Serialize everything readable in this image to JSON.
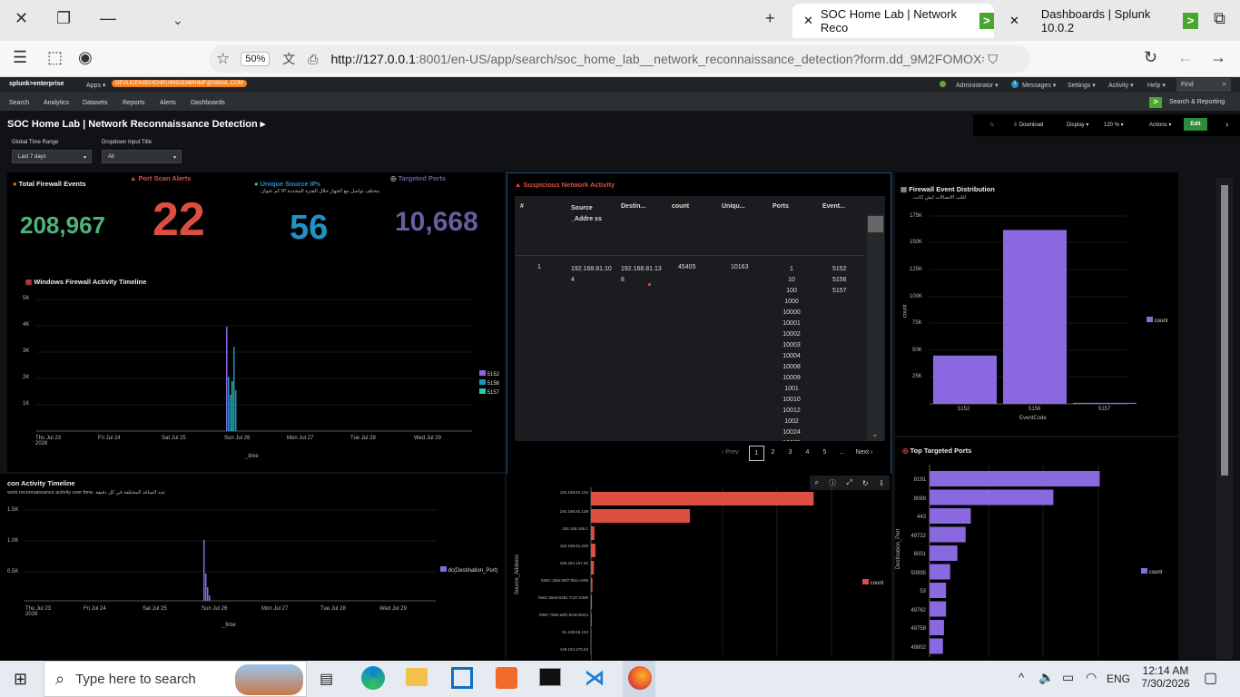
{
  "browser": {
    "tabs": [
      {
        "label": "SOC Home Lab | Network Reco"
      },
      {
        "label": "Dashboards | Splunk 10.0.2"
      }
    ],
    "zoom": "50%",
    "url_host": "http://127.0.0.1",
    "url_rest": ":8001/en-US/app/search/soc_home_lab__network_reconnaissance_detection?form.dd_9M2FOMOX=*&for"
  },
  "splunk": {
    "logo": "splunk>enterprise",
    "apps": "Apps ▾",
    "license_badge": "DEVLICENSEHDHRU4992636RHMF@GMAIL.COM",
    "admin": "Administrator ▾",
    "messages_count": "1",
    "messages": "Messages ▾",
    "settings": "Settings ▾",
    "activity": "Activity ▾",
    "help": "Help ▾",
    "find": "Find",
    "nav": [
      "Search",
      "Analytics",
      "Datasets",
      "Reports",
      "Alerts",
      "Dashboards"
    ],
    "app_name": "Search & Reporting"
  },
  "dashboard": {
    "title": "SOC Home Lab | Network Reconnaissance Detection ▸",
    "download": "Download",
    "display": "Display ▾",
    "zoom": "120 %",
    "actions": "Actions ▾",
    "edit": "Edit",
    "inputs": [
      {
        "label": "Global Time Range",
        "value": "Last 7 days"
      },
      {
        "label": "Dropdown Input Title",
        "value": "All"
      }
    ]
  },
  "kpis": [
    {
      "title": "Total Firewall Events",
      "value": "208,967",
      "color": "#4db37a"
    },
    {
      "title": "Port Scan Alerts",
      "value": "22",
      "color": "#dc4e41"
    },
    {
      "title": "Unique Source IPs",
      "subtitle": "مختلف تواصل مع الجهاز خلال الفترة المحددة IP كم عنوان",
      "value": "56",
      "color": "#1e93c6"
    },
    {
      "title": "Targeted Ports",
      "value": "10,668",
      "color": "#6a5c9e"
    }
  ],
  "timeline1": {
    "title": "Windows Firewall Activity Timeline",
    "xlabel": "_time",
    "yticks": [
      "5K",
      "4K",
      "3K",
      "2K",
      "1K"
    ],
    "xticks": [
      "Thu Jul 23\n2026",
      "Fri Jul 24",
      "Sat Jul 25",
      "Sun Jul 26",
      "Mon Jul 27",
      "Tue Jul 28",
      "Wed Jul 29"
    ],
    "legend": [
      {
        "name": "5152",
        "color": "#8a68e0"
      },
      {
        "name": "5156",
        "color": "#1e93c6"
      },
      {
        "name": "5157",
        "color": "#2ec6a4"
      }
    ]
  },
  "table": {
    "title": "Suspicious Network Activity",
    "headers": [
      "#",
      "Source _Addre ss",
      "Destin...",
      "count",
      "Uniqu...",
      "Ports",
      "Event..."
    ],
    "row": {
      "n": "1",
      "src": "192.168.81.104",
      "dst": "192.168.81.138",
      "count": "45405",
      "unique": "10163",
      "ports": [
        "1",
        "10",
        "100",
        "1000",
        "10000",
        "10001",
        "10002",
        "10003",
        "10004",
        "10008",
        "10009",
        "1001",
        "10010",
        "10012",
        "1002",
        "10024",
        "10025",
        "10030",
        "10053"
      ],
      "events": [
        "5152",
        "5156",
        "5157"
      ]
    },
    "pager": {
      "prev": "‹ Prev",
      "pages": [
        "1",
        "2",
        "3",
        "4",
        "5",
        "..."
      ],
      "next": "Next ›"
    }
  },
  "fw_dist": {
    "title": "Firewall Event Distribution",
    "subtitle": "اغلب الاتصالات ايش كانت",
    "ylabel": "count",
    "xlabel": "EventCode",
    "yticks": [
      "175K",
      "150K",
      "125K",
      "100K",
      "75K",
      "50K",
      "25K"
    ],
    "legend": "count"
  },
  "timeline2": {
    "title": "con Activity Timeline",
    "subtitle": "work reconnaissance activity over time. عدد المنافذ المختلفة في كل دقيقة",
    "xlabel": "_time",
    "yticks": [
      "1.5K",
      "1.0K",
      "0.5K"
    ],
    "xticks": [
      "Thu Jul 23\n2026",
      "Fri Jul 24",
      "Sat Jul 25",
      "Sun Jul 26",
      "Mon Jul 27",
      "Tue Jul 28",
      "Wed Jul 29"
    ],
    "legend": "dc(Destination_Port)"
  },
  "src_chart": {
    "ylabel": "Source_Address",
    "legend": "count"
  },
  "ports_chart": {
    "title": "Top Targeted Ports",
    "ylabel": "Destination_Port",
    "legend": "count"
  },
  "taskbar": {
    "search": "Type here to search",
    "lang": "ENG",
    "time": "12:14 AM",
    "date": "7/30/2026"
  },
  "chart_data": [
    {
      "type": "bar",
      "categories": [
        "5152",
        "5156",
        "5157"
      ],
      "values": [
        45000,
        162000,
        1000
      ],
      "ylim": [
        0,
        175000
      ]
    },
    {
      "type": "bar",
      "categories": [
        "192.168.81.104",
        "192.168.81.138",
        "192.168.195.1",
        "192.168.81.248",
        "169.254.167.92",
        "fe80::cd5e:b8f7:fe5c:ce96",
        "fe80::55e9:6481:7c27:4300",
        "fe80::7594:a8f1:9220:8024",
        "91.108.56.153",
        "149.154.175.53"
      ],
      "values": [
        45000,
        20000,
        700,
        900,
        600,
        300,
        200,
        150,
        100,
        80
      ]
    },
    {
      "type": "bar",
      "categories": [
        "8191",
        "8089",
        "443",
        "49722",
        "8001",
        "50995",
        "53",
        "49762",
        "49758",
        "49802"
      ],
      "values": [
        16500,
        12000,
        4000,
        3500,
        2700,
        2000,
        1600,
        1600,
        1400,
        1300
      ]
    }
  ]
}
